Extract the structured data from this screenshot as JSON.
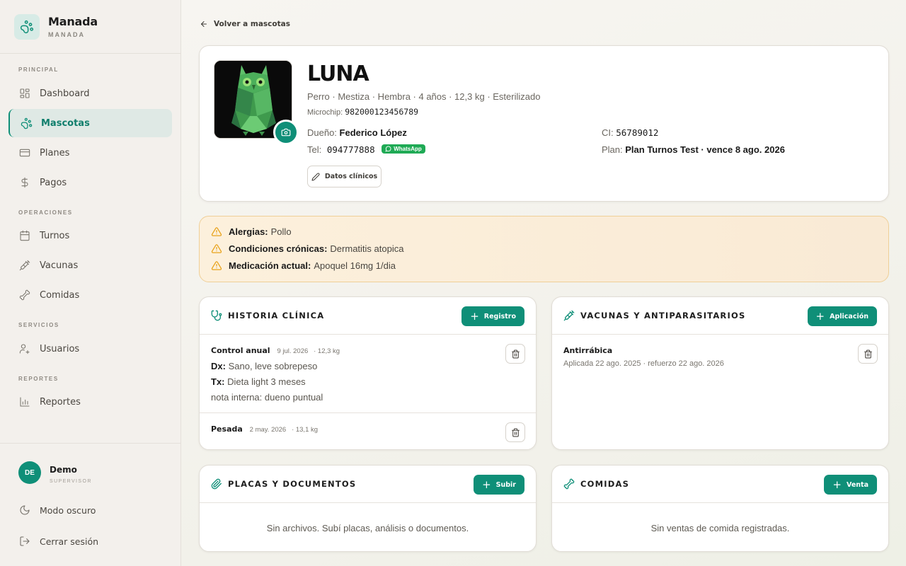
{
  "brand": {
    "name": "Manada",
    "sub": "MANADA"
  },
  "sidebar": {
    "sections": {
      "principal": "PRINCIPAL",
      "operaciones": "OPERACIONES",
      "servicios": "SERVICIOS",
      "reportes": "REPORTES"
    },
    "items": [
      {
        "label": "Dashboard",
        "icon": "grid-icon"
      },
      {
        "label": "Mascotas",
        "icon": "paw-icon"
      },
      {
        "label": "Planes",
        "icon": "card-icon"
      },
      {
        "label": "Pagos",
        "icon": "dollar-icon"
      },
      {
        "label": "Turnos",
        "icon": "calendar-icon"
      },
      {
        "label": "Vacunas",
        "icon": "syringe-icon"
      },
      {
        "label": "Comidas",
        "icon": "bone-icon"
      },
      {
        "label": "Usuarios",
        "icon": "users-icon"
      },
      {
        "label": "Reportes",
        "icon": "chart-icon"
      }
    ],
    "active": "Mascotas"
  },
  "user": {
    "initials": "DE",
    "name": "Demo",
    "role": "SUPERVISOR"
  },
  "footer": {
    "dark_mode": "Modo oscuro",
    "logout": "Cerrar sesión"
  },
  "back_link": "Volver a mascotas",
  "pet": {
    "name": "LUNA",
    "description": "Perro · Mestiza · Hembra · 4 años · 12,3 kg · Esterilizado",
    "microchip_label": "Microchip:",
    "microchip": "982000123456789",
    "owner_label": "Dueño:",
    "owner": "Federico López",
    "ci_label": "CI:",
    "ci": "56789012",
    "tel_label": "Tel:",
    "tel": "094777888",
    "whatsapp": "WhatsApp",
    "plan_label": "Plan:",
    "plan": "Plan Turnos Test · vence 8 ago. 2026",
    "clinical_button": "Datos clínicos"
  },
  "alerts": [
    {
      "label": "Alergias:",
      "value": "Pollo"
    },
    {
      "label": "Condiciones crónicas:",
      "value": "Dermatitis atopica"
    },
    {
      "label": "Medicación actual:",
      "value": "Apoquel 16mg 1/dia"
    }
  ],
  "historia": {
    "title": "HISTORIA CLÍNICA",
    "button": "Registro",
    "entries": [
      {
        "title": "Control anual",
        "date": "9 jul. 2026",
        "weight": "· 12,3 kg",
        "dx_label": "Dx:",
        "dx": "Sano, leve sobrepeso",
        "tx_label": "Tx:",
        "tx": "Dieta light 3 meses",
        "note": "nota interna: dueno puntual"
      },
      {
        "title": "Pesada",
        "date": "2 may. 2026",
        "weight": "· 13,1 kg"
      }
    ]
  },
  "vacunas": {
    "title": "VACUNAS Y ANTIPARASITARIOS",
    "button": "Aplicación",
    "entries": [
      {
        "title": "Antirrábica",
        "detail": "Aplicada 22 ago. 2025 · refuerzo 22 ago. 2026"
      }
    ]
  },
  "placas": {
    "title": "PLACAS Y DOCUMENTOS",
    "button": "Subir",
    "empty": "Sin archivos. Subí placas, análisis o documentos."
  },
  "comidas": {
    "title": "COMIDAS",
    "button": "Venta",
    "empty": "Sin ventas de comida registradas."
  },
  "colors": {
    "accent": "#0f8f78",
    "whatsapp": "#1faa55",
    "alert_bg": "#fcf0dc",
    "warning": "#e8a21a"
  }
}
